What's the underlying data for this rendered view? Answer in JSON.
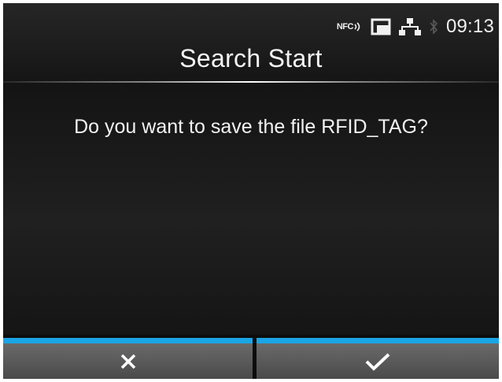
{
  "status_bar": {
    "nfc_label": "NFC",
    "time": "09:13",
    "icons": [
      "nfc-icon",
      "card-icon",
      "network-icon",
      "bluetooth-icon"
    ]
  },
  "dialog": {
    "title": "Search Start",
    "message": "Do you want to save the file RFID_TAG?"
  },
  "buttons": {
    "cancel_icon": "close-icon",
    "ok_icon": "checkmark-icon"
  },
  "colors": {
    "accent": "#1aa5e6",
    "background": "#0d0d0d",
    "button": "#5a5a5a",
    "text": "#f2f2f2"
  }
}
